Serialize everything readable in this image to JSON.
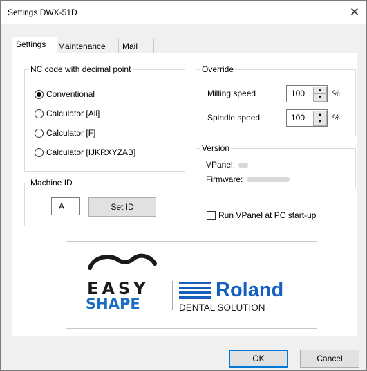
{
  "window": {
    "title": "Settings DWX-51D",
    "close_glyph": "✕"
  },
  "tabs": [
    {
      "label": "Settings",
      "active": true
    },
    {
      "label": "Maintenance",
      "active": false
    },
    {
      "label": "Mail",
      "active": false
    }
  ],
  "nc_code": {
    "legend": "NC code with decimal point",
    "options": [
      {
        "label": "Conventional",
        "selected": true
      },
      {
        "label": "Calculator [All]",
        "selected": false
      },
      {
        "label": "Calculator [F]",
        "selected": false
      },
      {
        "label": "Calculator [IJKRXYZAB]",
        "selected": false
      }
    ]
  },
  "override": {
    "legend": "Override",
    "milling": {
      "label": "Milling speed",
      "value": "100",
      "unit": "%"
    },
    "spindle": {
      "label": "Spindle speed",
      "value": "100",
      "unit": "%"
    }
  },
  "version": {
    "legend": "Version",
    "vpanel_label": "VPanel:",
    "firmware_label": "Firmware:"
  },
  "machine_id": {
    "legend": "Machine ID",
    "value": "A",
    "button": "Set ID"
  },
  "startup": {
    "label": "Run VPanel at PC start-up",
    "checked": false
  },
  "logo": {
    "easy": "EASY",
    "shape": "SHAPE",
    "brand": "Roland",
    "tagline": "DENTAL SOLUTION",
    "colors": {
      "dark": "#1a1a1a",
      "blue": "#1a6fc2",
      "roland_blue": "#1560bd",
      "light_blue": "#3a8fd8"
    }
  },
  "buttons": {
    "ok": "OK",
    "cancel": "Cancel"
  }
}
